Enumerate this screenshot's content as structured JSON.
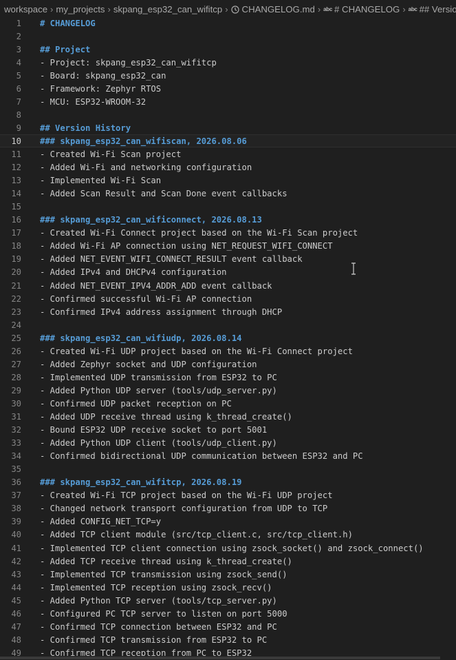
{
  "breadcrumb": {
    "items": [
      "workspace",
      "my_projects",
      "skpang_esp32_can_wifitcp",
      "CHANGELOG.md",
      "# CHANGELOG",
      "## Version"
    ],
    "file_icon": "clock-icon",
    "symbol_icon": "abc-icon",
    "abc_text": "abc"
  },
  "editor": {
    "current_line": 10,
    "colors": {
      "background": "#1f1f1f",
      "text": "#cccccc",
      "heading": "#569cd6",
      "line_number": "#858585"
    },
    "lines": [
      {
        "n": "1",
        "text": "# CHANGELOG",
        "heading": true
      },
      {
        "n": "2",
        "text": "",
        "heading": false
      },
      {
        "n": "3",
        "text": "## Project",
        "heading": true
      },
      {
        "n": "4",
        "text": "- Project: skpang_esp32_can_wifitcp",
        "heading": false
      },
      {
        "n": "5",
        "text": "- Board: skpang_esp32_can",
        "heading": false
      },
      {
        "n": "6",
        "text": "- Framework: Zephyr RTOS",
        "heading": false
      },
      {
        "n": "7",
        "text": "- MCU: ESP32-WROOM-32",
        "heading": false
      },
      {
        "n": "8",
        "text": "",
        "heading": false
      },
      {
        "n": "9",
        "text": "## Version History",
        "heading": true
      },
      {
        "n": "10",
        "text": "### skpang_esp32_can_wifiscan, 2026.08.06",
        "heading": true
      },
      {
        "n": "11",
        "text": "- Created Wi-Fi Scan project",
        "heading": false
      },
      {
        "n": "12",
        "text": "- Added Wi-Fi and networking configuration",
        "heading": false
      },
      {
        "n": "13",
        "text": "- Implemented Wi-Fi Scan",
        "heading": false
      },
      {
        "n": "14",
        "text": "- Added Scan Result and Scan Done event callbacks",
        "heading": false
      },
      {
        "n": "15",
        "text": "",
        "heading": false
      },
      {
        "n": "16",
        "text": "### skpang_esp32_can_wificonnect, 2026.08.13",
        "heading": true
      },
      {
        "n": "17",
        "text": "- Created Wi-Fi Connect project based on the Wi-Fi Scan project",
        "heading": false
      },
      {
        "n": "18",
        "text": "- Added Wi-Fi AP connection using NET_REQUEST_WIFI_CONNECT",
        "heading": false
      },
      {
        "n": "19",
        "text": "- Added NET_EVENT_WIFI_CONNECT_RESULT event callback",
        "heading": false
      },
      {
        "n": "20",
        "text": "- Added IPv4 and DHCPv4 configuration",
        "heading": false
      },
      {
        "n": "21",
        "text": "- Added NET_EVENT_IPV4_ADDR_ADD event callback",
        "heading": false
      },
      {
        "n": "22",
        "text": "- Confirmed successful Wi-Fi AP connection",
        "heading": false
      },
      {
        "n": "23",
        "text": "- Confirmed IPv4 address assignment through DHCP",
        "heading": false
      },
      {
        "n": "24",
        "text": "",
        "heading": false
      },
      {
        "n": "25",
        "text": "### skpang_esp32_can_wifiudp, 2026.08.14",
        "heading": true
      },
      {
        "n": "26",
        "text": "- Created Wi-Fi UDP project based on the Wi-Fi Connect project",
        "heading": false
      },
      {
        "n": "27",
        "text": "- Added Zephyr socket and UDP configuration",
        "heading": false
      },
      {
        "n": "28",
        "text": "- Implemented UDP transmission from ESP32 to PC",
        "heading": false
      },
      {
        "n": "29",
        "text": "- Added Python UDP server (tools/udp_server.py)",
        "heading": false
      },
      {
        "n": "30",
        "text": "- Confirmed UDP packet reception on PC",
        "heading": false
      },
      {
        "n": "31",
        "text": "- Added UDP receive thread using k_thread_create()",
        "heading": false
      },
      {
        "n": "32",
        "text": "- Bound ESP32 UDP receive socket to port 5001",
        "heading": false
      },
      {
        "n": "33",
        "text": "- Added Python UDP client (tools/udp_client.py)",
        "heading": false
      },
      {
        "n": "34",
        "text": "- Confirmed bidirectional UDP communication between ESP32 and PC",
        "heading": false
      },
      {
        "n": "35",
        "text": "",
        "heading": false
      },
      {
        "n": "36",
        "text": "### skpang_esp32_can_wifitcp, 2026.08.19",
        "heading": true
      },
      {
        "n": "37",
        "text": "- Created Wi-Fi TCP project based on the Wi-Fi UDP project",
        "heading": false
      },
      {
        "n": "38",
        "text": "- Changed network transport configuration from UDP to TCP",
        "heading": false
      },
      {
        "n": "39",
        "text": "- Added CONFIG_NET_TCP=y",
        "heading": false
      },
      {
        "n": "40",
        "text": "- Added TCP client module (src/tcp_client.c, src/tcp_client.h)",
        "heading": false
      },
      {
        "n": "41",
        "text": "- Implemented TCP client connection using zsock_socket() and zsock_connect()",
        "heading": false
      },
      {
        "n": "42",
        "text": "- Added TCP receive thread using k_thread_create()",
        "heading": false
      },
      {
        "n": "43",
        "text": "- Implemented TCP transmission using zsock_send()",
        "heading": false
      },
      {
        "n": "44",
        "text": "- Implemented TCP reception using zsock_recv()",
        "heading": false
      },
      {
        "n": "45",
        "text": "- Added Python TCP server (tools/tcp_server.py)",
        "heading": false
      },
      {
        "n": "46",
        "text": "- Configured PC TCP server to listen on port 5000",
        "heading": false
      },
      {
        "n": "47",
        "text": "- Confirmed TCP connection between ESP32 and PC",
        "heading": false
      },
      {
        "n": "48",
        "text": "- Confirmed TCP transmission from ESP32 to PC",
        "heading": false
      },
      {
        "n": "49",
        "text": "- Confirmed TCP reception from PC to ESP32",
        "heading": false
      }
    ]
  }
}
